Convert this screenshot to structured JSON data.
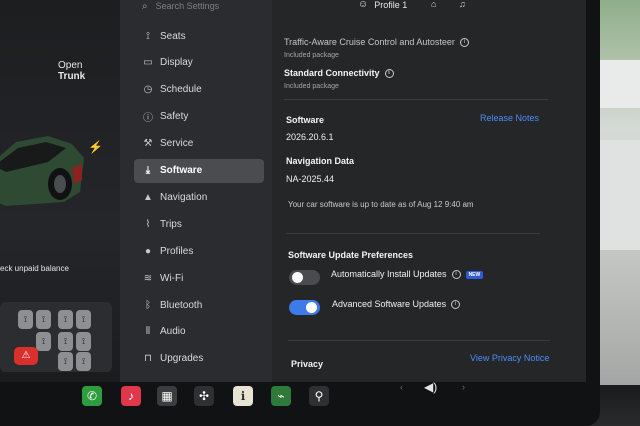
{
  "car": {
    "trunk_line1": "Open",
    "trunk_line2": "Trunk",
    "unpaid_text": "eck unpaid balance",
    "bolt_icon": "lightning-bolt"
  },
  "search": {
    "placeholder": "Search Settings"
  },
  "topbar": {
    "profile_label": "Profile 1"
  },
  "sidebar": {
    "items": [
      {
        "label": "Seats",
        "icon": "seat-icon",
        "glyph": "⟟"
      },
      {
        "label": "Display",
        "icon": "display-icon",
        "glyph": "▭"
      },
      {
        "label": "Schedule",
        "icon": "clock-icon",
        "glyph": "◷"
      },
      {
        "label": "Safety",
        "icon": "safety-icon",
        "glyph": "ⓘ"
      },
      {
        "label": "Service",
        "icon": "wrench-icon",
        "glyph": "⚒"
      },
      {
        "label": "Software",
        "icon": "download-icon",
        "glyph": "⤓",
        "active": true
      },
      {
        "label": "Navigation",
        "icon": "navigation-icon",
        "glyph": "▲"
      },
      {
        "label": "Trips",
        "icon": "trips-icon",
        "glyph": "⌇"
      },
      {
        "label": "Profiles",
        "icon": "profile-icon",
        "glyph": "●"
      },
      {
        "label": "Wi-Fi",
        "icon": "wifi-icon",
        "glyph": "≋"
      },
      {
        "label": "Bluetooth",
        "icon": "bluetooth-icon",
        "glyph": "ᛒ"
      },
      {
        "label": "Audio",
        "icon": "audio-icon",
        "glyph": "⫴"
      },
      {
        "label": "Upgrades",
        "icon": "bag-icon",
        "glyph": "⊓"
      }
    ]
  },
  "content": {
    "tacc_line": "Traffic-Aware Cruise Control and Autosteer",
    "tacc_sub": "Included package",
    "connectivity_label": "Standard Connectivity",
    "connectivity_sub": "Included package",
    "software_heading": "Software",
    "release_notes_link": "Release Notes",
    "software_version": "2026.20.6.1",
    "nav_data_heading": "Navigation Data",
    "nav_data_version": "NA-2025.44",
    "status_text": "Your car software is up to date as of Aug 12 9:40 am",
    "prefs_heading": "Software Update Preferences",
    "auto_install_label": "Automatically Install Updates",
    "auto_install_on": false,
    "new_badge": "NEW",
    "advanced_label": "Advanced Software Updates",
    "advanced_on": true,
    "privacy_heading": "Privacy",
    "privacy_link": "View Privacy Notice"
  },
  "dock": [
    {
      "icon": "phone-icon",
      "color": "#2e9d3e",
      "glyph": "✆"
    },
    {
      "icon": "music-icon",
      "color": "#e0384a",
      "glyph": "♪"
    },
    {
      "icon": "apps-icon",
      "color": "#3a3c3f",
      "glyph": "▦"
    },
    {
      "icon": "fan-icon",
      "color": "#2f3033",
      "glyph": "✣"
    },
    {
      "icon": "manual-icon",
      "color": "#e8e4d4",
      "glyph": "ℹ"
    },
    {
      "icon": "energy-icon",
      "color": "#2f7a3a",
      "glyph": "⌁"
    },
    {
      "icon": "joystick-icon",
      "color": "#2f3033",
      "glyph": "⚲"
    }
  ],
  "colors": {
    "accent": "#4d8df5",
    "toggle_on": "#3e7be8",
    "brake_red": "#d9302d"
  }
}
